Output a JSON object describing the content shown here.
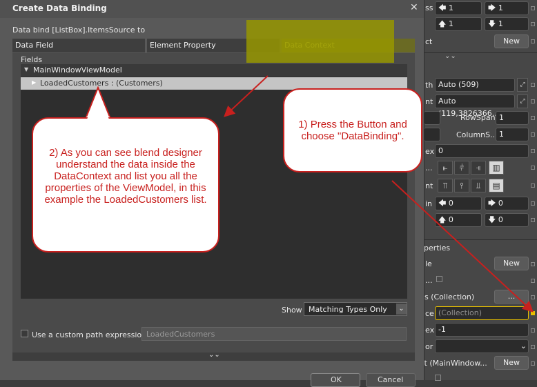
{
  "dialog": {
    "title": "Create Data Binding",
    "close_glyph": "✕",
    "subtitle": "Data bind [ListBox].ItemsSource to",
    "tabs": [
      "Data Field",
      "Element Property",
      "Data Context"
    ],
    "fields_label": "Fields",
    "tree": {
      "root": "MainWindowViewModel",
      "child": "LoadedCustomers : (Customers)"
    },
    "show_label": "Show",
    "show_value": "Matching Types Only",
    "custom_path_label": "Use a custom path expression",
    "custom_path_value": "LoadedCustomers",
    "ok_label": "OK",
    "cancel_label": "Cancel"
  },
  "property_panel": {
    "row1_label": "ss",
    "row1_left": "1",
    "row1_right": "1",
    "row2_left": "1",
    "row2_right": "1",
    "row3_label": "ct",
    "new_label": "New",
    "width_label": "th",
    "width_value": "Auto (509)",
    "height_label": "nt",
    "height_value": "Auto (119,3826366...",
    "rowspan_label": "RowSpan",
    "rowspan_value": "1",
    "columnspan_label": "ColumnS...",
    "columnspan_value": "1",
    "zindex_label": "ex",
    "zindex_value": "0",
    "margin_label": "in",
    "margin_left": "0",
    "margin_right": "0",
    "margin_bottom_left": "0",
    "margin_bottom_right": "0",
    "common_header": "perties",
    "style_label": "le",
    "style_new": "New",
    "items_label": "ns (Collection)",
    "items_btn": "...",
    "itemssource_label": "ce",
    "itemssource_value": "(Collection)",
    "selectedindex_label": "ex",
    "selectedindex_value": "-1",
    "selector_label": "or",
    "datacontext_label": "xt (MainWindow...",
    "datacontext_new": "New"
  },
  "annotations": {
    "callout1": "1) Press the Button and choose \"DataBinding\".",
    "callout2": "2) As you can see blend designer understand the data inside the DataContext and list you all the properties of the ViewModel, in this example the LoadedCustomers list.",
    "callout_color": "#c8201e",
    "highlight_color": "#969600"
  }
}
